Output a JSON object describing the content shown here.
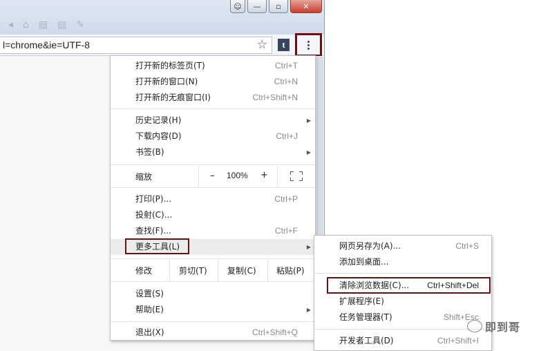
{
  "window": {
    "minimize": "—",
    "restore": "▫",
    "close": "✕",
    "user": "👤"
  },
  "address": {
    "url_fragment": "l=chrome&ie=UTF-8"
  },
  "icons": {
    "star": "star-icon",
    "tumblr": "t",
    "menu": "kebab-icon"
  },
  "menu": {
    "new_tab": {
      "label": "打开新的标签页(T)",
      "shortcut": "Ctrl+T"
    },
    "new_window": {
      "label": "打开新的窗口(N)",
      "shortcut": "Ctrl+N"
    },
    "incognito": {
      "label": "打开新的无痕窗口(I)",
      "shortcut": "Ctrl+Shift+N"
    },
    "history": {
      "label": "历史记录(H)"
    },
    "downloads": {
      "label": "下载内容(D)",
      "shortcut": "Ctrl+J"
    },
    "bookmarks": {
      "label": "书签(B)"
    },
    "zoom": {
      "label": "缩放",
      "minus": "–",
      "value": "100%",
      "plus": "+"
    },
    "print": {
      "label": "打印(P)...",
      "shortcut": "Ctrl+P"
    },
    "cast": {
      "label": "投射(C)..."
    },
    "find": {
      "label": "查找(F)...",
      "shortcut": "Ctrl+F"
    },
    "more_tools": {
      "label": "更多工具(L)"
    },
    "edit": {
      "label": "修改",
      "cut": "剪切(T)",
      "copy": "复制(C)",
      "paste": "粘贴(P)"
    },
    "settings": {
      "label": "设置(S)"
    },
    "help": {
      "label": "帮助(E)"
    },
    "exit": {
      "label": "退出(X)",
      "shortcut": "Ctrl+Shift+Q"
    }
  },
  "submenu": {
    "save_page": {
      "label": "网页另存为(A)...",
      "shortcut": "Ctrl+S"
    },
    "add_desktop": {
      "label": "添加到桌面..."
    },
    "clear_data": {
      "label": "清除浏览数据(C)...",
      "shortcut": "Ctrl+Shift+Del"
    },
    "extensions": {
      "label": "扩展程序(E)"
    },
    "task_manager": {
      "label": "任务管理器(T)",
      "shortcut": "Shift+Esc"
    },
    "dev_tools": {
      "label": "开发者工具(D)",
      "shortcut": "Ctrl+Shift+I"
    }
  },
  "watermark": {
    "text": "即到哥"
  }
}
